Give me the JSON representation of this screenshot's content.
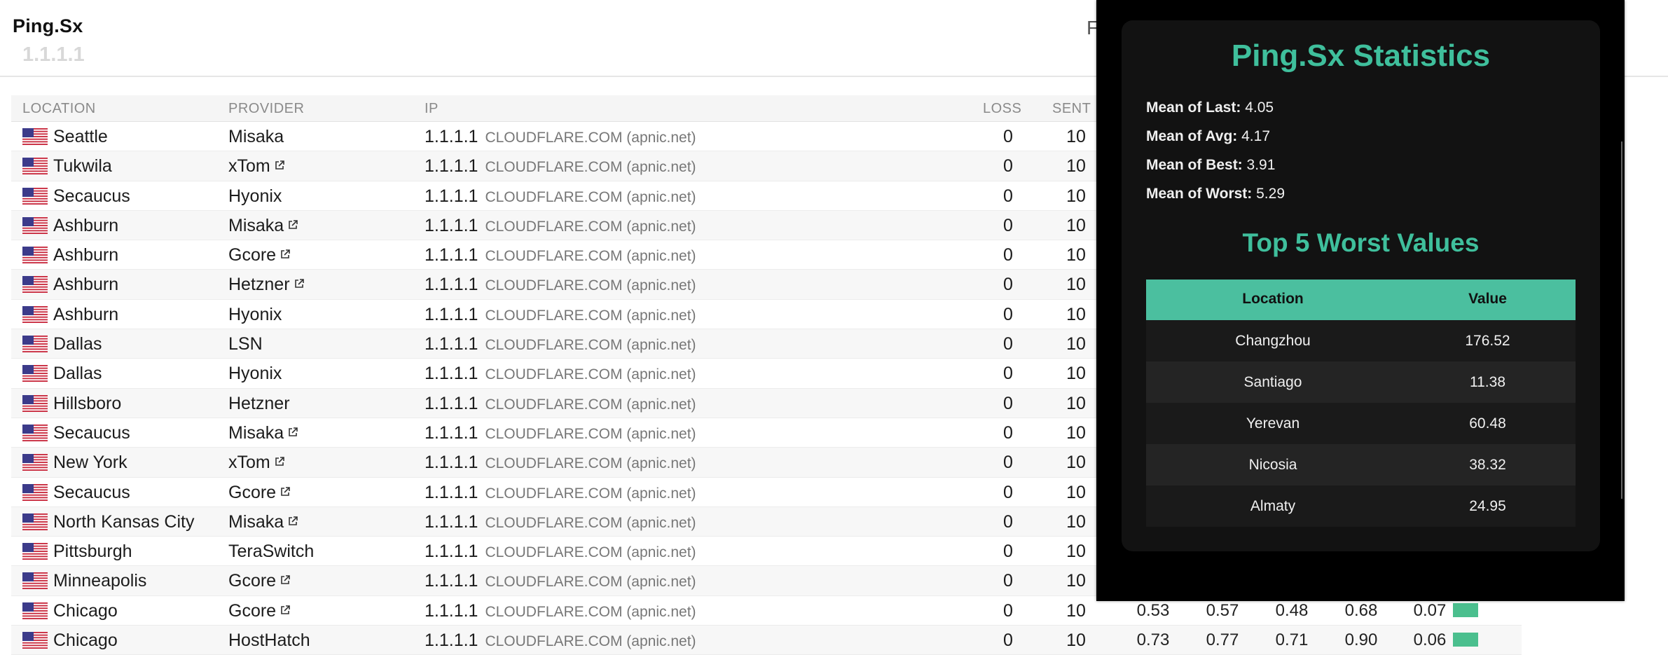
{
  "app": {
    "title": "Ping.Sx",
    "target": "1.1.1.1",
    "header_partial": "F"
  },
  "table": {
    "columns": {
      "location": "LOCATION",
      "provider": "PROVIDER",
      "ip": "IP",
      "loss": "LOSS",
      "sent": "SENT"
    },
    "rows": [
      {
        "location": "Seattle",
        "provider": "Misaka",
        "ext": false,
        "ip": "1.1.1.1",
        "ipname": "CLOUDFLARE.COM (apnic.net)",
        "loss": "0",
        "sent": "10"
      },
      {
        "location": "Tukwila",
        "provider": "xTom",
        "ext": true,
        "ip": "1.1.1.1",
        "ipname": "CLOUDFLARE.COM (apnic.net)",
        "loss": "0",
        "sent": "10"
      },
      {
        "location": "Secaucus",
        "provider": "Hyonix",
        "ext": false,
        "ip": "1.1.1.1",
        "ipname": "CLOUDFLARE.COM (apnic.net)",
        "loss": "0",
        "sent": "10"
      },
      {
        "location": "Ashburn",
        "provider": "Misaka",
        "ext": true,
        "ip": "1.1.1.1",
        "ipname": "CLOUDFLARE.COM (apnic.net)",
        "loss": "0",
        "sent": "10"
      },
      {
        "location": "Ashburn",
        "provider": "Gcore",
        "ext": true,
        "ip": "1.1.1.1",
        "ipname": "CLOUDFLARE.COM (apnic.net)",
        "loss": "0",
        "sent": "10"
      },
      {
        "location": "Ashburn",
        "provider": "Hetzner",
        "ext": true,
        "ip": "1.1.1.1",
        "ipname": "CLOUDFLARE.COM (apnic.net)",
        "loss": "0",
        "sent": "10"
      },
      {
        "location": "Ashburn",
        "provider": "Hyonix",
        "ext": false,
        "ip": "1.1.1.1",
        "ipname": "CLOUDFLARE.COM (apnic.net)",
        "loss": "0",
        "sent": "10"
      },
      {
        "location": "Dallas",
        "provider": "LSN",
        "ext": false,
        "ip": "1.1.1.1",
        "ipname": "CLOUDFLARE.COM (apnic.net)",
        "loss": "0",
        "sent": "10"
      },
      {
        "location": "Dallas",
        "provider": "Hyonix",
        "ext": false,
        "ip": "1.1.1.1",
        "ipname": "CLOUDFLARE.COM (apnic.net)",
        "loss": "0",
        "sent": "10"
      },
      {
        "location": "Hillsboro",
        "provider": "Hetzner",
        "ext": false,
        "ip": "1.1.1.1",
        "ipname": "CLOUDFLARE.COM (apnic.net)",
        "loss": "0",
        "sent": "10"
      },
      {
        "location": "Secaucus",
        "provider": "Misaka",
        "ext": true,
        "ip": "1.1.1.1",
        "ipname": "CLOUDFLARE.COM (apnic.net)",
        "loss": "0",
        "sent": "10"
      },
      {
        "location": "New York",
        "provider": "xTom",
        "ext": true,
        "ip": "1.1.1.1",
        "ipname": "CLOUDFLARE.COM (apnic.net)",
        "loss": "0",
        "sent": "10"
      },
      {
        "location": "Secaucus",
        "provider": "Gcore",
        "ext": true,
        "ip": "1.1.1.1",
        "ipname": "CLOUDFLARE.COM (apnic.net)",
        "loss": "0",
        "sent": "10"
      },
      {
        "location": "North Kansas City",
        "provider": "Misaka",
        "ext": true,
        "ip": "1.1.1.1",
        "ipname": "CLOUDFLARE.COM (apnic.net)",
        "loss": "0",
        "sent": "10"
      },
      {
        "location": "Pittsburgh",
        "provider": "TeraSwitch",
        "ext": false,
        "ip": "1.1.1.1",
        "ipname": "CLOUDFLARE.COM (apnic.net)",
        "loss": "0",
        "sent": "10"
      },
      {
        "location": "Minneapolis",
        "provider": "Gcore",
        "ext": true,
        "ip": "1.1.1.1",
        "ipname": "CLOUDFLARE.COM (apnic.net)",
        "loss": "0",
        "sent": "10"
      },
      {
        "location": "Chicago",
        "provider": "Gcore",
        "ext": true,
        "ip": "1.1.1.1",
        "ipname": "CLOUDFLARE.COM (apnic.net)",
        "loss": "0",
        "sent": "10",
        "stats": [
          "0.53",
          "0.57",
          "0.48",
          "0.68",
          "0.07"
        ]
      },
      {
        "location": "Chicago",
        "provider": "HostHatch",
        "ext": false,
        "ip": "1.1.1.1",
        "ipname": "CLOUDFLARE.COM (apnic.net)",
        "loss": "0",
        "sent": "10",
        "stats": [
          "0.73",
          "0.77",
          "0.71",
          "0.90",
          "0.06"
        ]
      }
    ]
  },
  "popup": {
    "title": "Ping.Sx Statistics",
    "means": [
      {
        "label": "Mean of Last:",
        "value": "4.05"
      },
      {
        "label": "Mean of Avg:",
        "value": "4.17"
      },
      {
        "label": "Mean of Best:",
        "value": "3.91"
      },
      {
        "label": "Mean of Worst:",
        "value": "5.29"
      }
    ],
    "worst_title": "Top 5 Worst Values",
    "worst_headers": {
      "location": "Location",
      "value": "Value"
    },
    "worst": [
      {
        "location": "Changzhou",
        "value": "176.52"
      },
      {
        "location": "Santiago",
        "value": "11.38"
      },
      {
        "location": "Yerevan",
        "value": "60.48"
      },
      {
        "location": "Nicosia",
        "value": "38.32"
      },
      {
        "location": "Almaty",
        "value": "24.95"
      }
    ]
  },
  "colors": {
    "accent": "#3fbf9c",
    "chip": "#4bbf8e"
  },
  "icons": {
    "flag": "us-flag-icon",
    "external": "external-link-icon"
  }
}
